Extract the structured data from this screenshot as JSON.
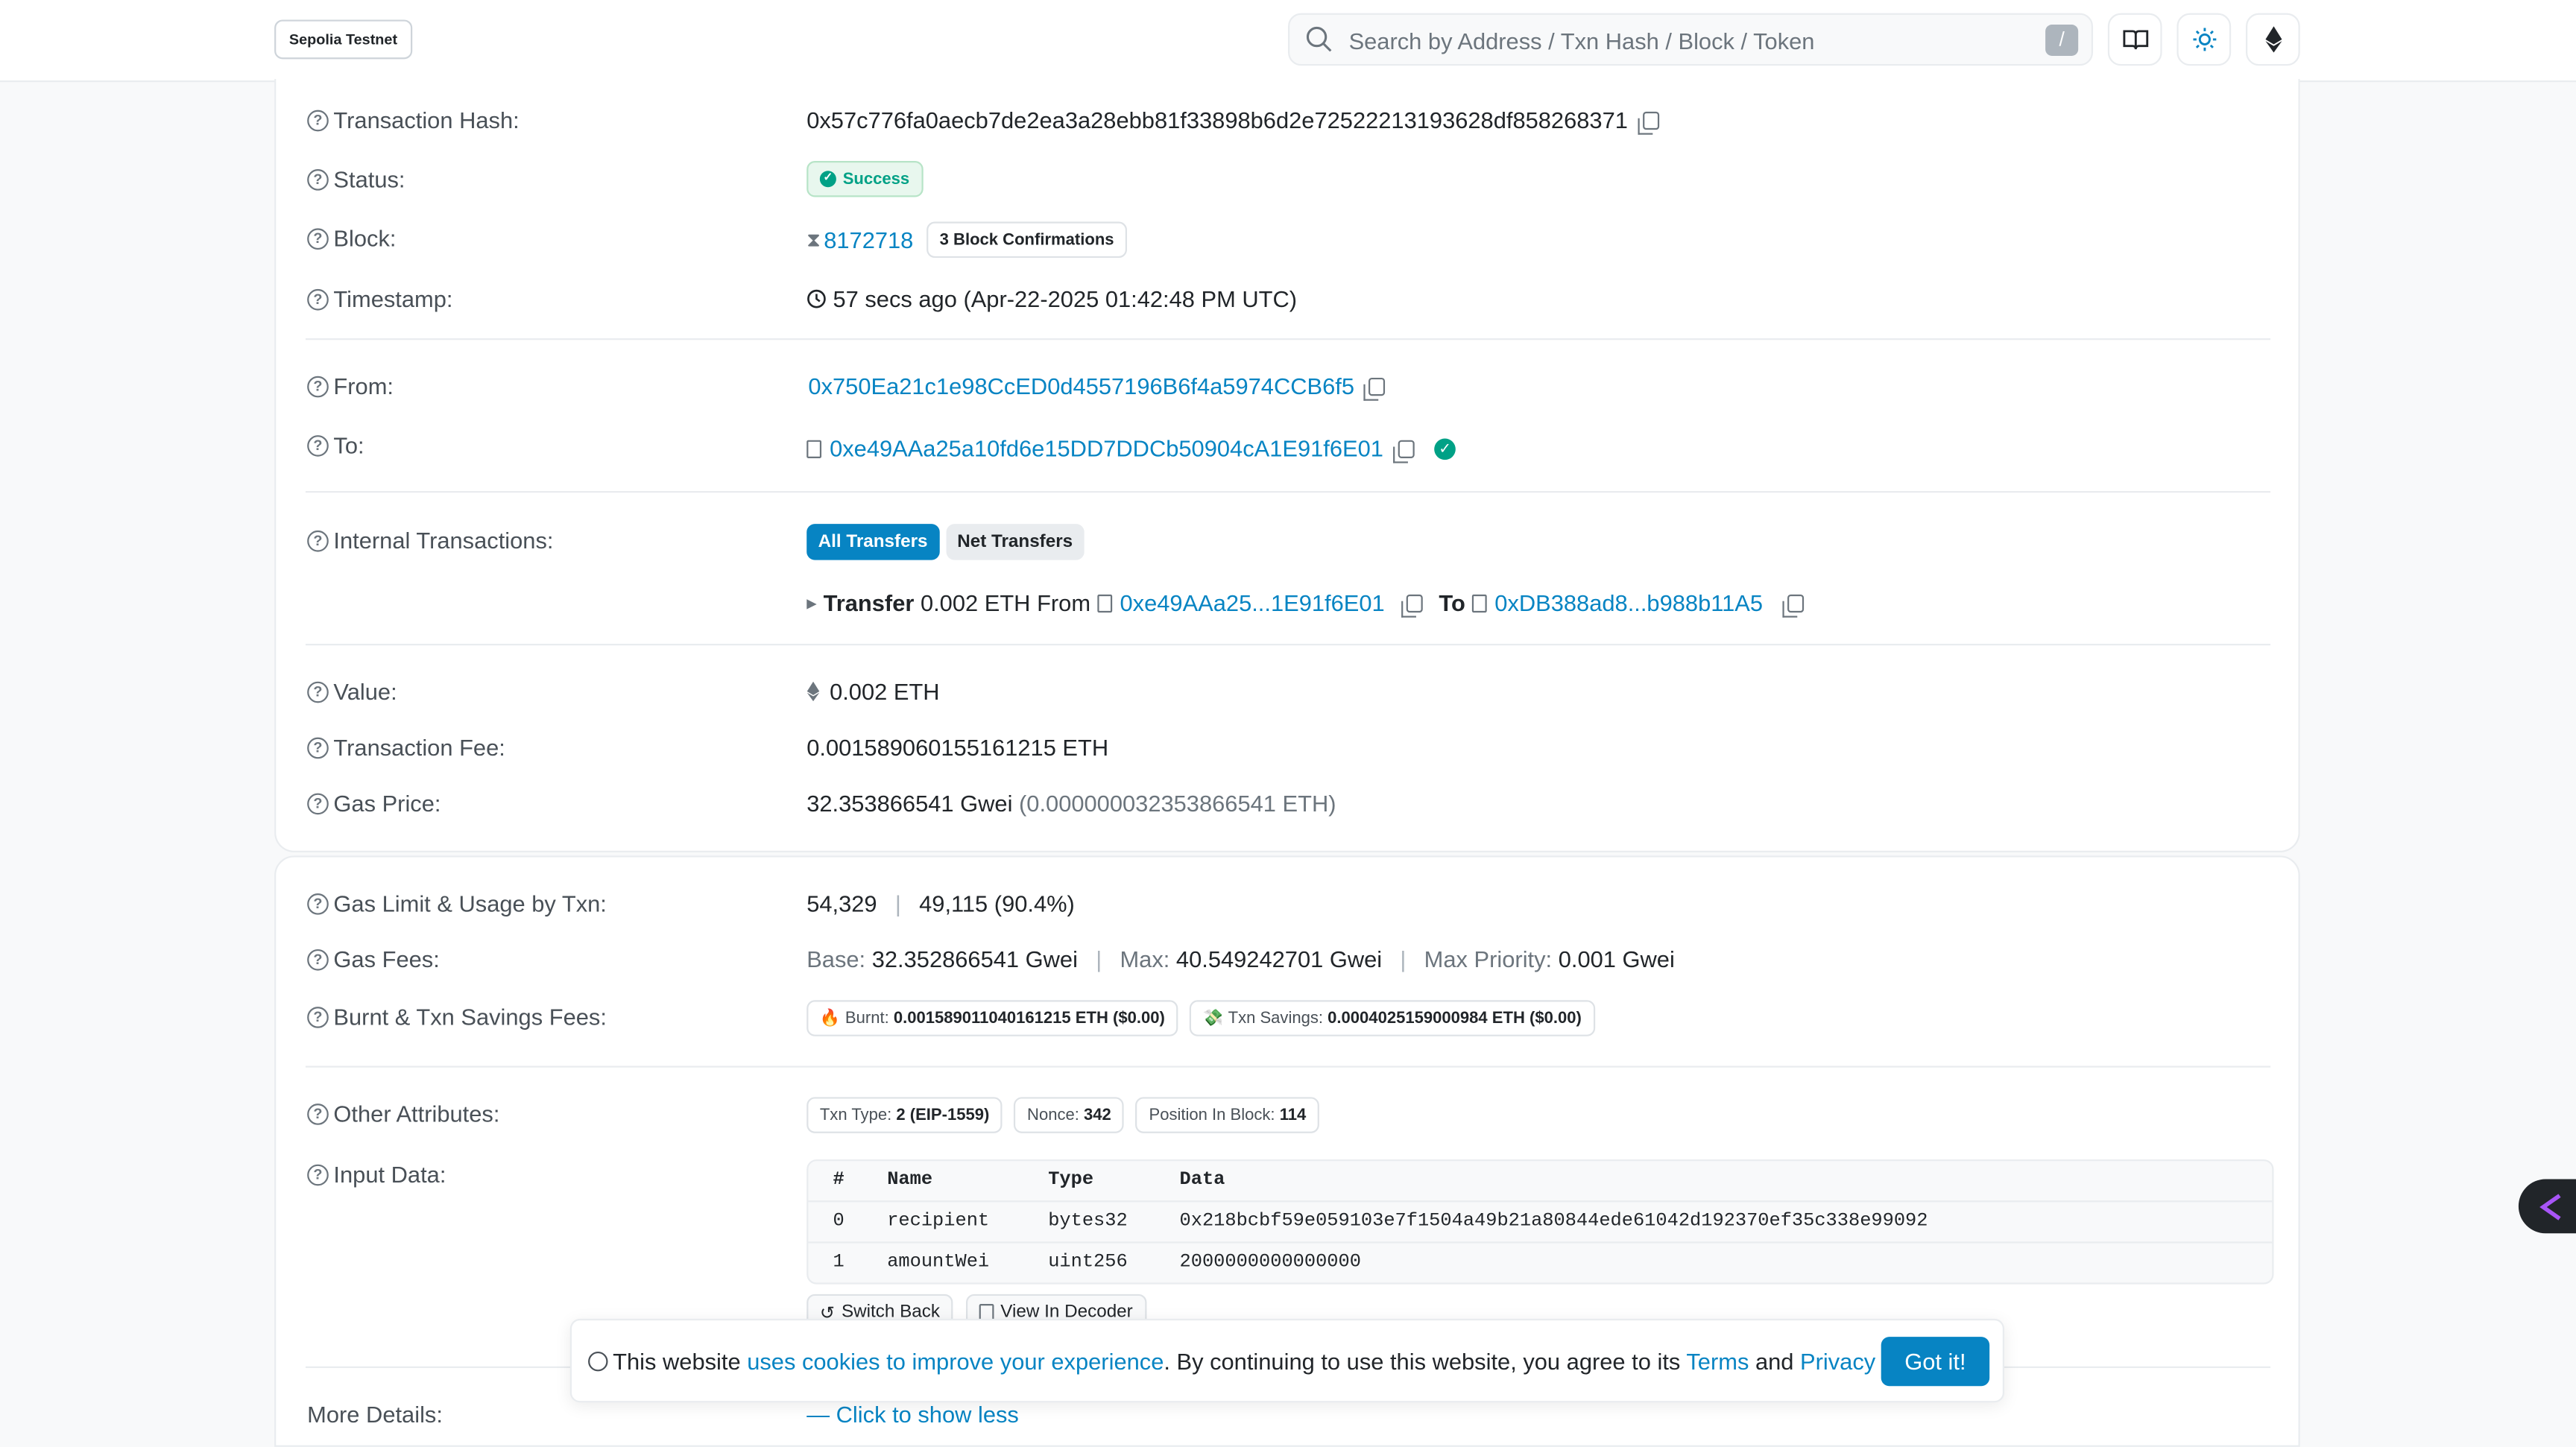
{
  "header": {
    "network": "Sepolia Testnet",
    "search_placeholder": "Search by Address / Txn Hash / Block / Token",
    "search_shortcut": "/"
  },
  "overview": {
    "hash_label": "Transaction Hash:",
    "hash": "0x57c776fa0aecb7de2ea3a28ebb81f33898b6d2e72522213193628df858268371",
    "status_label": "Status:",
    "status": "Success",
    "block_label": "Block:",
    "block": "8172718",
    "confirmations": "3 Block Confirmations",
    "timestamp_label": "Timestamp:",
    "timestamp": "57 secs ago (Apr-22-2025 01:42:48 PM UTC)",
    "from_label": "From:",
    "from": "0x750Ea21c1e98CcED0d4557196B6f4a5974CCB6f5",
    "to_label": "To:",
    "to": "0xe49AAa25a10fd6e15DD7DDCb50904cA1E91f6E01",
    "internal_label": "Internal Transactions:",
    "tab_all": "All Transfers",
    "tab_net": "Net Transfers",
    "transfer_prefix": "Transfer",
    "transfer_amount": "0.002 ETH",
    "transfer_from_word": "From",
    "transfer_from": "0xe49AAa25...1E91f6E01",
    "transfer_to_word": "To",
    "transfer_to": "0xDB388ad8...b988b11A5",
    "value_label": "Value:",
    "value": "0.002 ETH",
    "fee_label": "Transaction Fee:",
    "fee": "0.001589060155161215 ETH",
    "gas_price_label": "Gas Price:",
    "gas_price": "32.353866541 Gwei",
    "gas_price_eth": "(0.000000032353866541 ETH)"
  },
  "details": {
    "gas_limit_label": "Gas Limit & Usage by Txn:",
    "gas_limit": "54,329",
    "gas_used": "49,115 (90.4%)",
    "gas_fees_label": "Gas Fees:",
    "base_key": "Base:",
    "base_val": "32.352866541 Gwei",
    "max_key": "Max:",
    "max_val": "40.549242701 Gwei",
    "prio_key": "Max Priority:",
    "prio_val": "0.001 Gwei",
    "burnt_label": "Burnt & Txn Savings Fees:",
    "burnt_key": "Burnt:",
    "burnt_val": "0.001589011040161215 ETH ($0.00)",
    "savings_key": "Txn Savings:",
    "savings_val": "0.0004025159000984 ETH ($0.00)",
    "other_label": "Other Attributes:",
    "txn_type_key": "Txn Type:",
    "txn_type_val": "2 (EIP-1559)",
    "nonce_key": "Nonce:",
    "nonce_val": "342",
    "position_key": "Position In Block:",
    "position_val": "114",
    "input_label": "Input Data:",
    "input_headers": [
      "#",
      "Name",
      "Type",
      "Data"
    ],
    "input_rows": [
      [
        "0",
        "recipient",
        "bytes32",
        "0x218bcbf59e059103e7f1504a49b21a80844ede61042d192370ef35c338e99092"
      ],
      [
        "1",
        "amountWei",
        "uint256",
        "2000000000000000"
      ]
    ],
    "switch_back": "Switch Back",
    "view_decoder": "View In Decoder",
    "more_label": "More Details:",
    "more_link": "— Click to show less"
  },
  "cookie": {
    "t1": "This website ",
    "l1": "uses cookies to improve your experience",
    "t2": ". By continuing to use this website, you agree to its ",
    "l2": "Terms",
    "t3": " and ",
    "l3": "Privacy Policy",
    "t4": ".",
    "button": "Got it!"
  },
  "colors": {
    "accent": "#0784c3",
    "success": "#00a186"
  }
}
